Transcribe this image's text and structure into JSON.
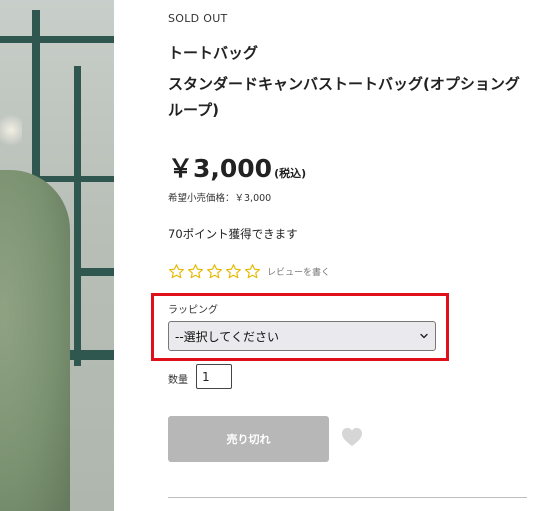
{
  "product": {
    "status": "SOLD OUT",
    "category": "トートバッグ",
    "title": "スタンダードキャンバストートバッグ(オプショングループ)",
    "price": "￥3,000",
    "tax_note": "(税込)",
    "msrp": "希望小売価格：￥3,000",
    "points": "70ポイント獲得できます"
  },
  "review": {
    "stars": 0,
    "max_stars": 5,
    "star_icon": "star-outline-icon",
    "star_color": "#e6b800",
    "link_label": "レビューを書く"
  },
  "options": {
    "wrapping_label": "ラッピング",
    "wrapping_selected": "--選択してください"
  },
  "quantity": {
    "label": "数量",
    "value": "1"
  },
  "actions": {
    "soldout_label": "売り切れ",
    "favorite_icon": "heart-icon"
  },
  "colors": {
    "highlight": "#e0101a",
    "button_disabled": "#b7b7b7"
  }
}
